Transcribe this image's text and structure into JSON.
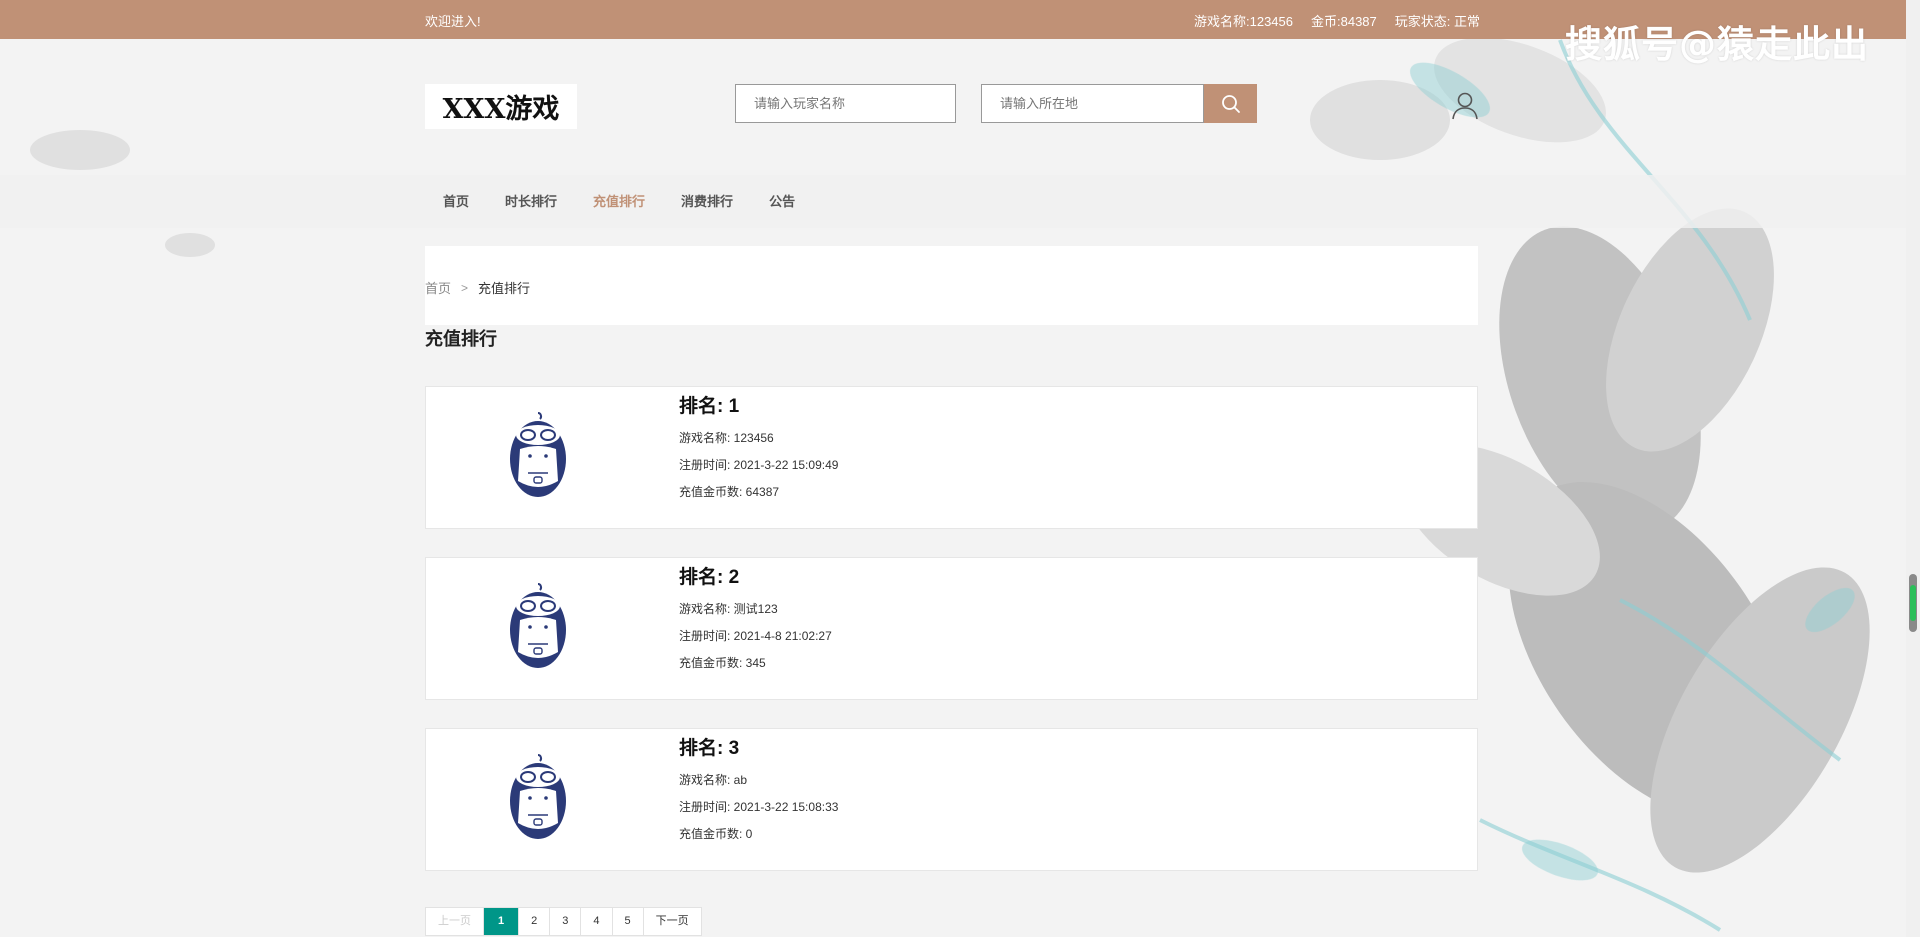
{
  "topbar": {
    "welcome": "欢迎进入!",
    "game_name": "游戏名称:123456",
    "coins": "金币:84387",
    "status": "玩家状态: 正常"
  },
  "watermark": "搜狐号@猿走此出",
  "header": {
    "logo": "XXX游戏",
    "player_search_placeholder": "请输入玩家名称",
    "location_search_placeholder": "请输入所在地"
  },
  "nav": {
    "items": [
      {
        "label": "首页"
      },
      {
        "label": "时长排行"
      },
      {
        "label": "充值排行"
      },
      {
        "label": "消费排行"
      },
      {
        "label": "公告"
      }
    ],
    "active_index": 2
  },
  "breadcrumb": {
    "home": "首页",
    "separator": ">",
    "current": "充值排行"
  },
  "page_title": "充值排行",
  "players": [
    {
      "rank": "排名: 1",
      "game_name": "游戏名称: 123456",
      "reg_time": "注册时间: 2021-3-22 15:09:49",
      "recharge": "充值金币数: 64387"
    },
    {
      "rank": "排名: 2",
      "game_name": "游戏名称: 测试123",
      "reg_time": "注册时间: 2021-4-8 21:02:27",
      "recharge": "充值金币数: 345"
    },
    {
      "rank": "排名: 3",
      "game_name": "游戏名称: ab",
      "reg_time": "注册时间: 2021-3-22 15:08:33",
      "recharge": "充值金币数: 0"
    }
  ],
  "pagination": {
    "prev": "上一页",
    "pages": [
      "1",
      "2",
      "3",
      "4",
      "5"
    ],
    "current": "1",
    "next": "下一页"
  },
  "colors": {
    "brand": "#c09176",
    "page_active": "#009688"
  }
}
